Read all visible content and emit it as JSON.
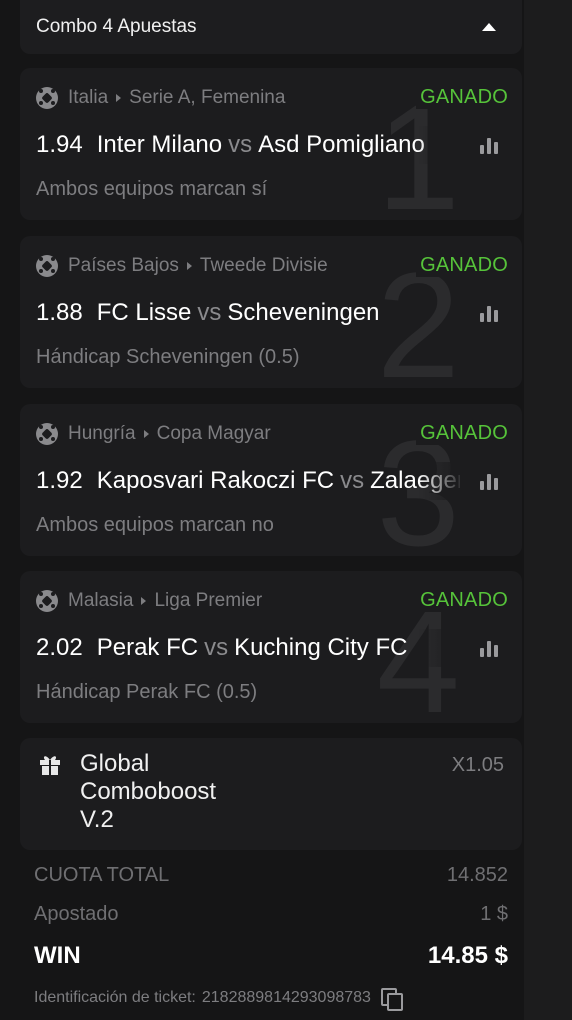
{
  "header": {
    "title": "Combo 4 Apuestas"
  },
  "bets": [
    {
      "number": "1",
      "country": "Italia",
      "league": "Serie A, Femenina",
      "status": "GANADO",
      "odds": "1.94",
      "home": "Inter Milano",
      "vs": "vs",
      "away": "Asd Pomigliano",
      "market": "Ambos equipos marcan sí"
    },
    {
      "number": "2",
      "country": "Países Bajos",
      "league": "Tweede Divisie",
      "status": "GANADO",
      "odds": "1.88",
      "home": "FC Lisse",
      "vs": "vs",
      "away": "Scheveningen",
      "market": "Hándicap Scheveningen (0.5)"
    },
    {
      "number": "3",
      "country": "Hungría",
      "league": "Copa Magyar",
      "status": "GANADO",
      "odds": "1.92",
      "home": "Kaposvari Rakoczi FC",
      "vs": "vs",
      "away": "Zalaegerszeg",
      "market": "Ambos equipos marcan no"
    },
    {
      "number": "4",
      "country": "Malasia",
      "league": "Liga Premier",
      "status": "GANADO",
      "odds": "2.02",
      "home": "Perak FC",
      "vs": "vs",
      "away": "Kuching City FC",
      "market": "Hándicap Perak FC (0.5)"
    }
  ],
  "boost": {
    "line1": "Global",
    "line2": "Comboboost",
    "line3": "V.2",
    "multiplier": "X1.05"
  },
  "summary": {
    "total_odds_label": "CUOTA TOTAL",
    "total_odds_value": "14.852",
    "stake_label": "Apostado",
    "stake_value": "1 $",
    "win_label": "WIN",
    "win_value": "14.85 $"
  },
  "ticket": {
    "label": "Identificación de ticket:",
    "id": "2182889814293098783"
  },
  "colors": {
    "won": "#56c33a",
    "background": "#151516",
    "card": "#1c1c1e"
  },
  "icons": [
    "chevron-up-icon",
    "soccer-ball-icon",
    "stats-icon",
    "gift-icon",
    "copy-icon"
  ]
}
